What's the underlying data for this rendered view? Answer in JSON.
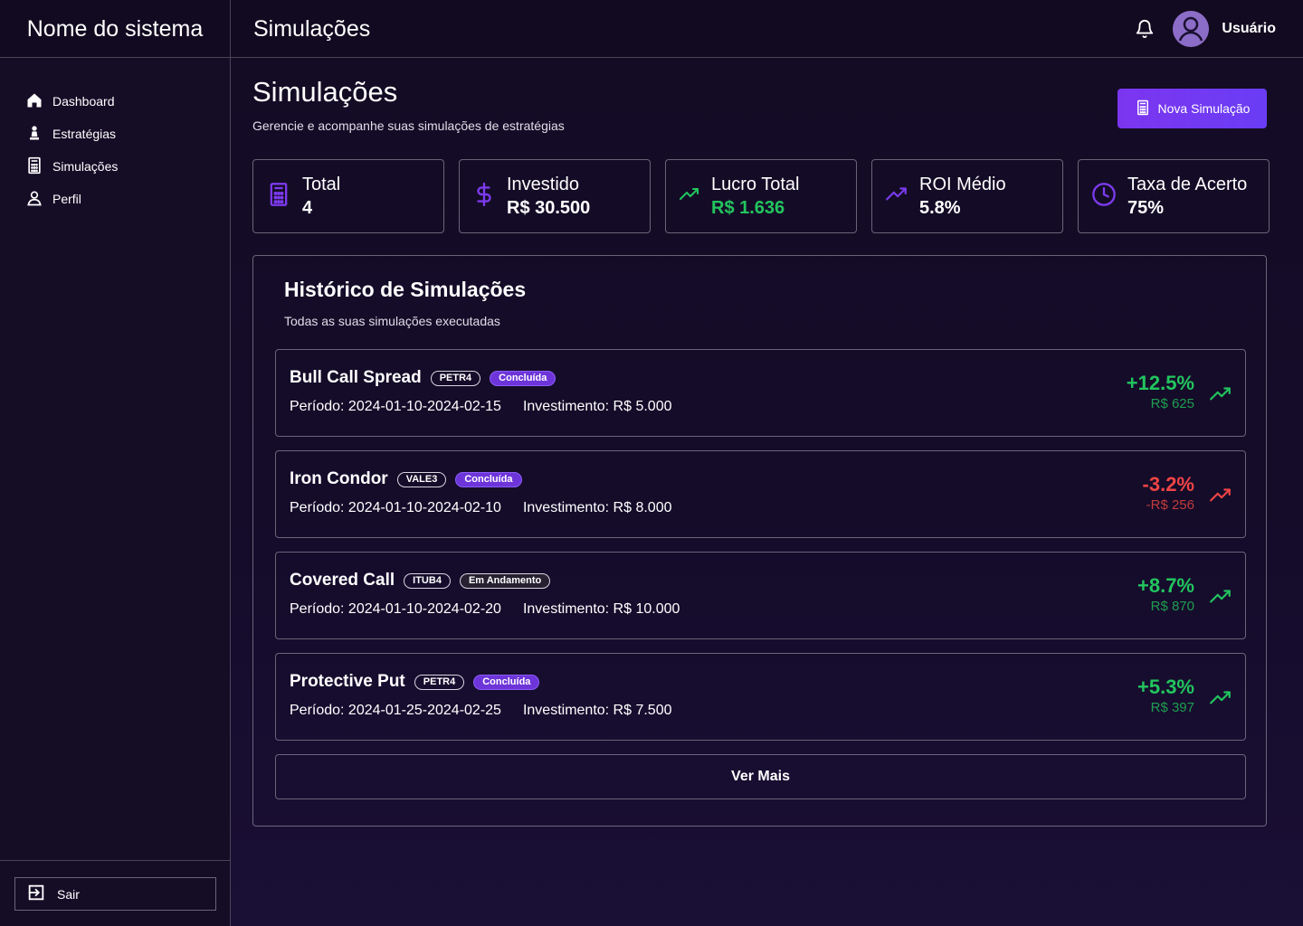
{
  "header": {
    "brand": "Nome do sistema",
    "page_title": "Simulações",
    "username": "Usuário"
  },
  "sidebar": {
    "items": [
      {
        "label": "Dashboard",
        "icon": "home-icon"
      },
      {
        "label": "Estratégias",
        "icon": "chess-pawn-icon"
      },
      {
        "label": "Simulações",
        "icon": "calculator-icon"
      },
      {
        "label": "Perfil",
        "icon": "user-icon"
      }
    ],
    "logout_label": "Sair"
  },
  "main": {
    "title": "Simulações",
    "subtitle": "Gerencie e acompanhe suas simulações de estratégias",
    "new_button_label": "Nova Simulação"
  },
  "stats": [
    {
      "label": "Total",
      "value": "4",
      "icon": "calculator-icon",
      "color": "#7c3aed"
    },
    {
      "label": "Investido",
      "value": "R$ 30.500",
      "icon": "dollar-icon",
      "color": "#7c3aed"
    },
    {
      "label": "Lucro Total",
      "value": "R$ 1.636",
      "icon": "trending-up-icon",
      "color": "#22c55e"
    },
    {
      "label": "ROI Médio",
      "value": "5.8%",
      "icon": "trending-up-icon",
      "color": "#7c3aed"
    },
    {
      "label": "Taxa de Acerto",
      "value": "75%",
      "icon": "clock-icon",
      "color": "#7c3aed"
    }
  ],
  "history": {
    "title": "Histórico de Simulações",
    "subtitle": "Todas as suas simulações executadas",
    "period_prefix": "Período:",
    "investment_prefix": "Investimento:",
    "items": [
      {
        "name": "Bull Call Spread",
        "ticker": "PETR4",
        "status": "Concluída",
        "period": "Período: 2024-01-10-2024-02-15",
        "investment": "Investimento: R$ 5.000",
        "pct": "+12.5%",
        "amount": "R$ 625",
        "positive": true
      },
      {
        "name": "Iron Condor",
        "ticker": "VALE3",
        "status": "Concluída",
        "period": "Período: 2024-01-10-2024-02-10",
        "investment": "Investimento: R$ 8.000",
        "pct": "-3.2%",
        "amount": "-R$ 256",
        "positive": false
      },
      {
        "name": "Covered Call",
        "ticker": "ITUB4",
        "status": "Em Andamento",
        "period": "Período: 2024-01-10-2024-02-20",
        "investment": "Investimento: R$ 10.000",
        "pct": "+8.7%",
        "amount": "R$ 870",
        "positive": true
      },
      {
        "name": "Protective Put",
        "ticker": "PETR4",
        "status": "Concluída",
        "period": "Período: 2024-01-25-2024-02-25",
        "investment": "Investimento: R$ 7.500",
        "pct": "+5.3%",
        "amount": "R$ 397",
        "positive": true
      }
    ],
    "more_label": "Ver Mais"
  },
  "colors": {
    "accent": "#7c3aed",
    "positive": "#22c55e",
    "negative": "#ef4444",
    "background": "#150c2b"
  }
}
